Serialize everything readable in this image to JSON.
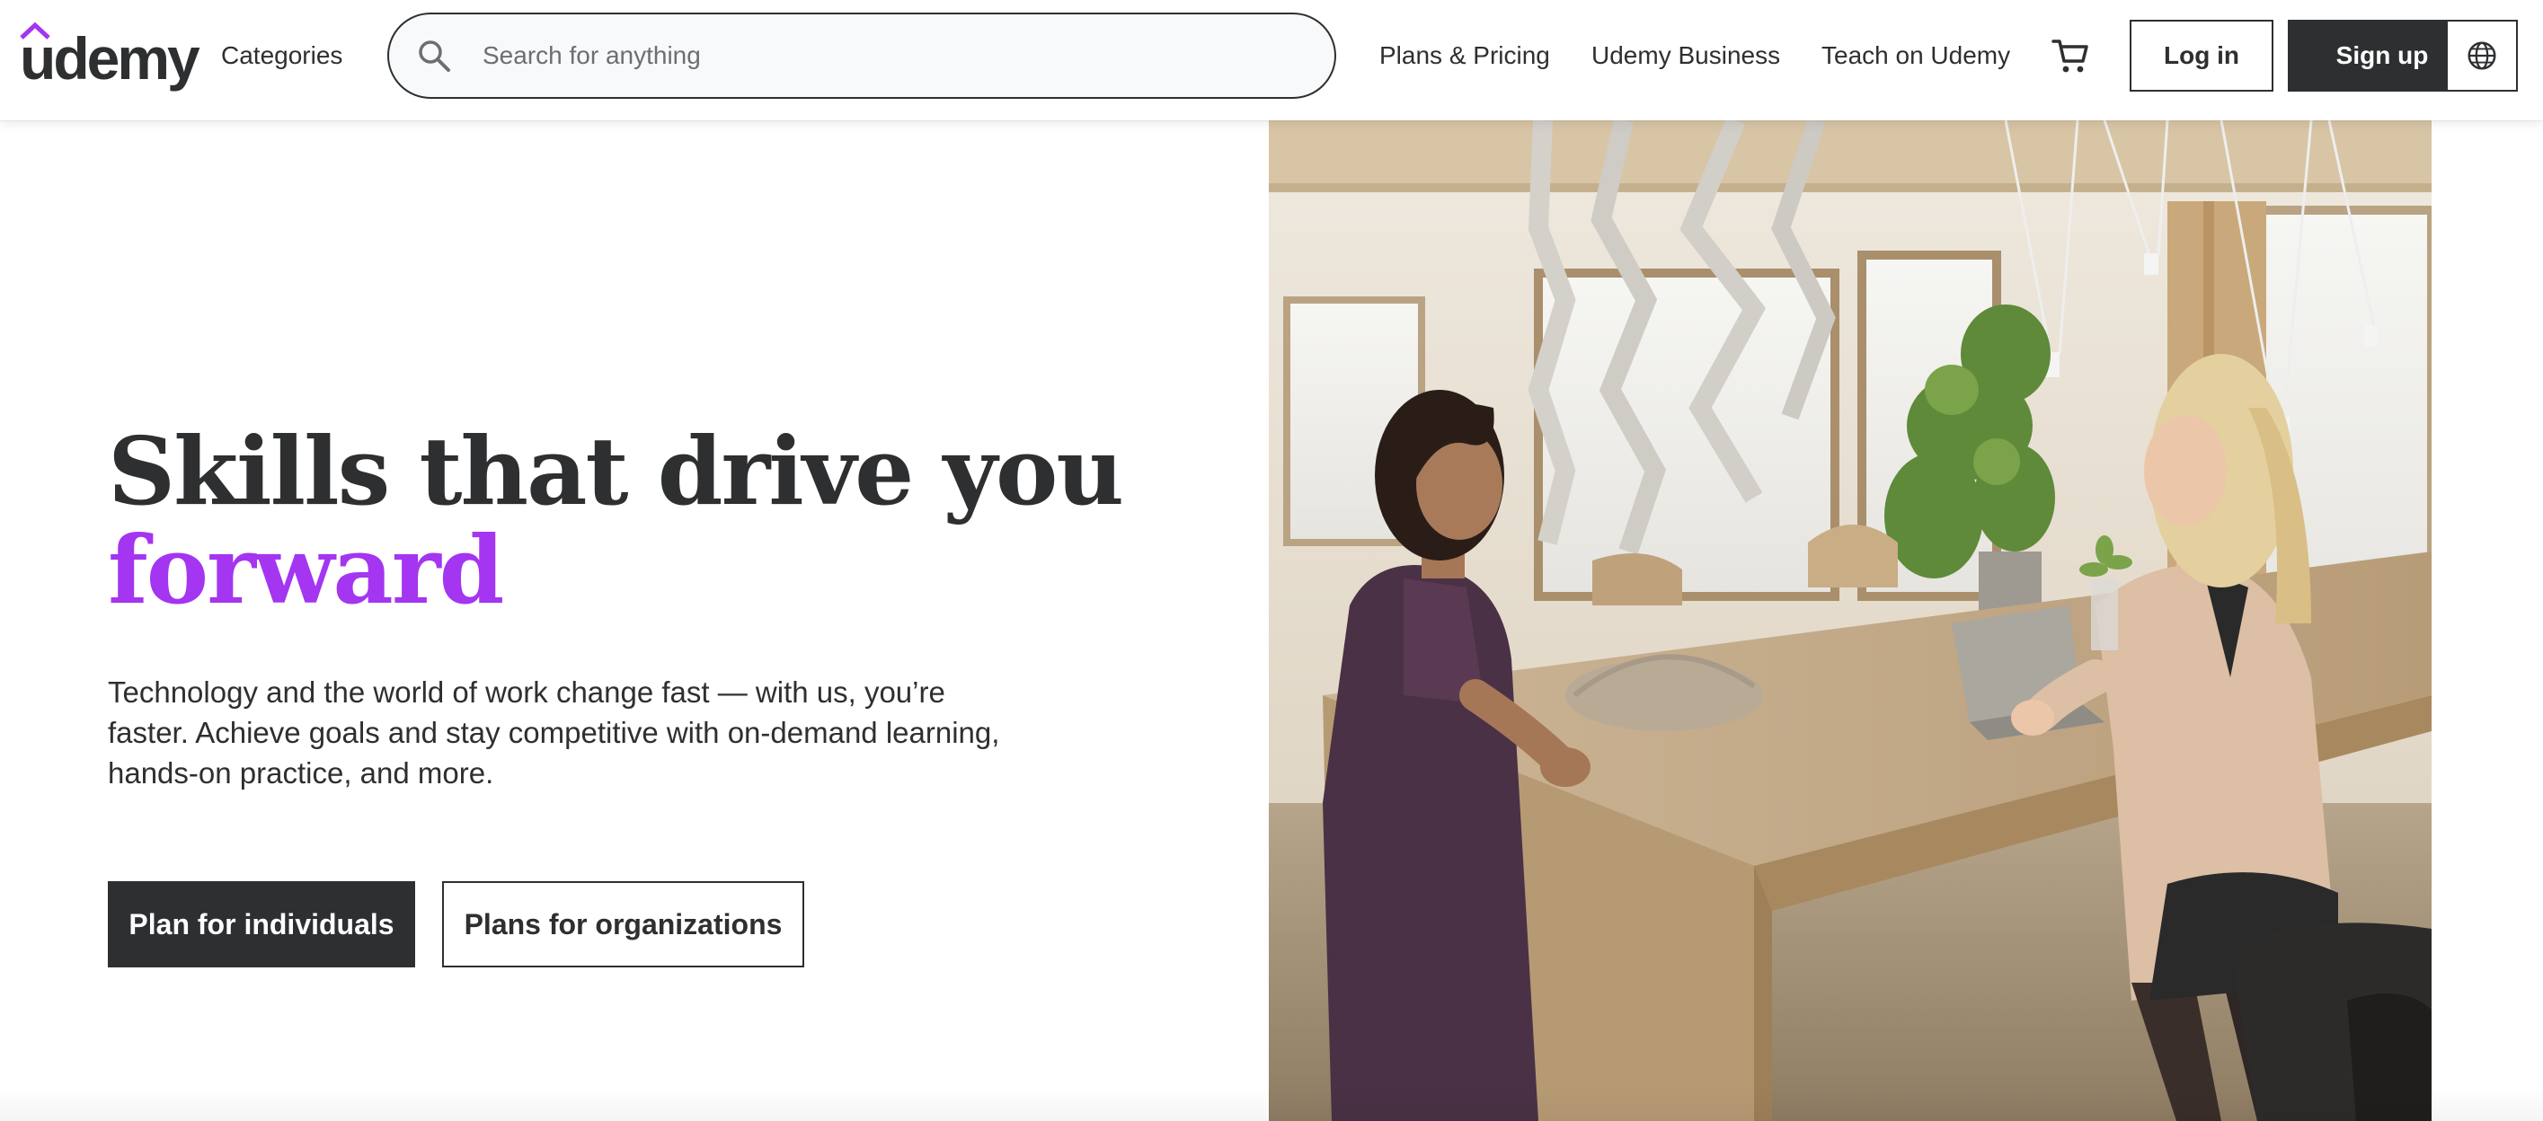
{
  "header": {
    "logo_text": "udemy",
    "categories_label": "Categories",
    "search": {
      "placeholder": "Search for anything",
      "value": ""
    },
    "nav": {
      "plans_pricing": "Plans & Pricing",
      "business": "Udemy Business",
      "teach": "Teach on Udemy"
    },
    "login_label": "Log in",
    "signup_label": "Sign up",
    "icons": {
      "search": "search-icon",
      "cart": "cart-icon",
      "language": "globe-icon",
      "logo_mark": "udemy-logo-mark"
    }
  },
  "hero": {
    "title_line1": "Skills that drive you",
    "title_line2": "forward",
    "subtitle": "Technology and the world of work change fast — with us, you’re faster. Achieve goals and stay competitive with on-demand learning, hands-on practice, and more.",
    "primary_cta": "Plan for individuals",
    "secondary_cta": "Plans for organizations"
  },
  "colors": {
    "brand_purple": "#a435f0",
    "text_dark": "#2d2f31",
    "search_bg": "#f7f9fa",
    "muted_text": "#6a6f73"
  }
}
